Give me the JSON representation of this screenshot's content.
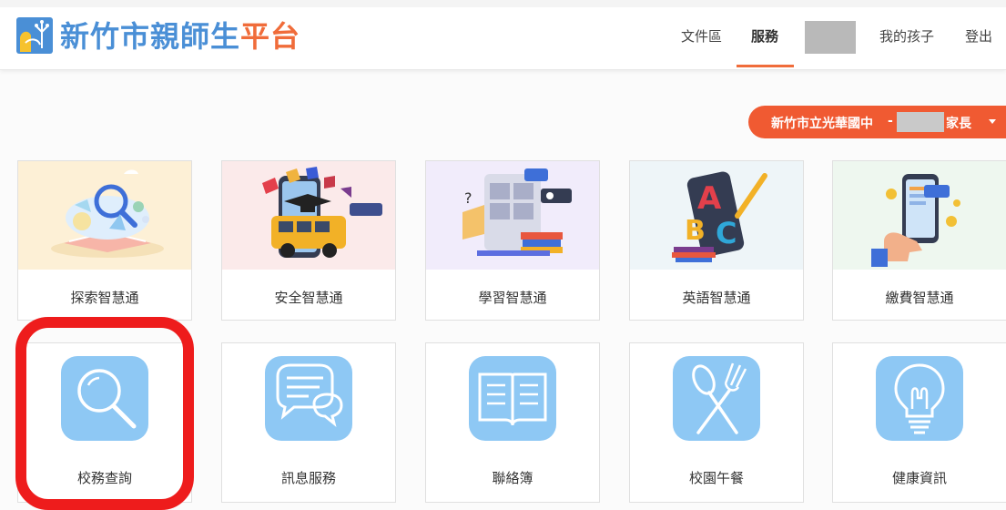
{
  "brand": {
    "part1": "新竹市親師生",
    "part2": "平台"
  },
  "nav": {
    "docs": "文件區",
    "services": "服務",
    "children": "我的孩子",
    "logout": "登出"
  },
  "role": {
    "school": "新竹市立光華國中",
    "dash": "-",
    "role": "家長"
  },
  "accent_color": "#f05a32",
  "brand_blue": "#4a8fd6",
  "cards_row1": [
    {
      "label": "探索智慧通",
      "icon": "explore-illustration"
    },
    {
      "label": "安全智慧通",
      "icon": "school-bus-illustration"
    },
    {
      "label": "學習智慧通",
      "icon": "learning-illustration"
    },
    {
      "label": "英語智慧通",
      "icon": "abc-illustration"
    },
    {
      "label": "繳費智慧通",
      "icon": "payment-illustration"
    }
  ],
  "cards_row2": [
    {
      "label": "校務查詢",
      "icon": "magnifier-icon"
    },
    {
      "label": "訊息服務",
      "icon": "chat-bubble-icon"
    },
    {
      "label": "聯絡簿",
      "icon": "open-book-icon"
    },
    {
      "label": "校園午餐",
      "icon": "spoon-fork-icon"
    },
    {
      "label": "健康資訊",
      "icon": "lightbulb-icon"
    }
  ]
}
